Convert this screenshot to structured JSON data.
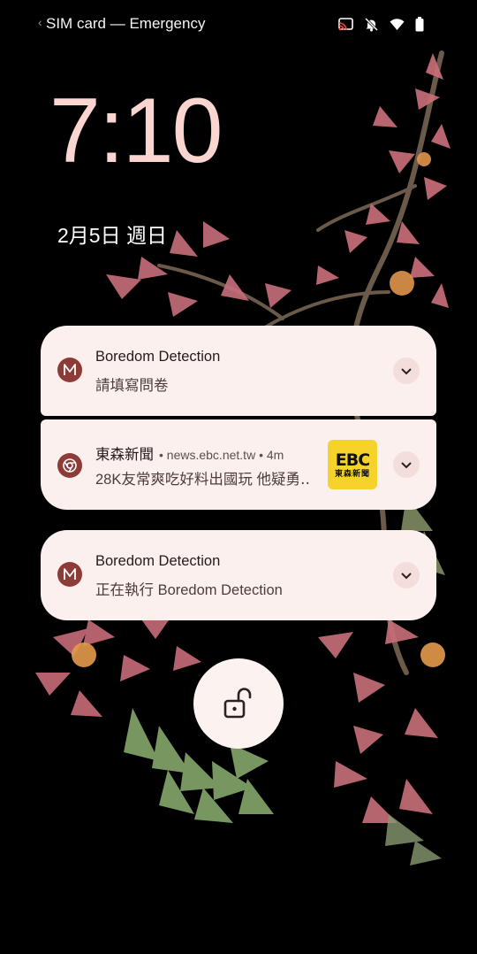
{
  "status_bar": {
    "carrier_text": "SIM card — Emergency",
    "icons": [
      "cast-icon",
      "bell-off-icon",
      "wifi-icon",
      "battery-icon"
    ]
  },
  "lockscreen": {
    "time": "7:10",
    "date": "2月5日 週日"
  },
  "notifications": [
    {
      "app_icon": "boredom-detection-icon",
      "title": "Boredom Detection",
      "body": "請填寫問卷"
    },
    {
      "app_icon": "chrome-icon",
      "title": "東森新聞",
      "meta": "• news.ebc.net.tw • 4m",
      "body": "28K友常爽吃好料出國玩 他疑勇‥",
      "thumbnail_logo": "EBC",
      "thumbnail_caption": "東森新聞"
    },
    {
      "app_icon": "boredom-detection-icon",
      "title": "Boredom Detection",
      "body": "正在執行 Boredom Detection"
    }
  ],
  "colors": {
    "clock": "#fbd6d0",
    "notification_bg": "#fcf0ee",
    "app_icon_bg": "#8c3b36",
    "thumbnail_bg": "#f6d32a"
  },
  "unlock_icon": "unlock-icon"
}
